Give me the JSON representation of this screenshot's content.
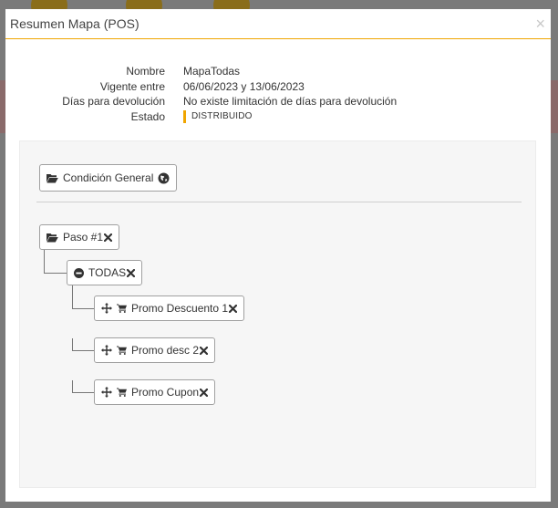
{
  "modal": {
    "title": "Resumen Mapa (POS)",
    "close": "×"
  },
  "info": {
    "rows": [
      {
        "label": "Nombre",
        "value": "MapaTodas"
      },
      {
        "label": "Vigente entre",
        "value": "06/06/2023 y 13/06/2023"
      },
      {
        "label": "Días para devolución",
        "value": "No existe limitación de días para devolución"
      }
    ],
    "status_label": "Estado",
    "status_value": "DISTRIBUIDO",
    "status_color": "#f0a500"
  },
  "tree": {
    "general": {
      "label": "Condición General",
      "icon": "folder-open-icon",
      "right_icon": "globe-icon"
    },
    "step": {
      "label": "Paso #1",
      "icon": "folder-open-icon",
      "remove": "remove-icon"
    },
    "group": {
      "label": "TODAS",
      "icon": "minus-circle-icon",
      "remove": "remove-icon"
    },
    "promos": [
      {
        "label": "Promo Descuento 1",
        "icon": "cart-icon",
        "handle": "move-icon"
      },
      {
        "label": "Promo desc 2",
        "icon": "cart-icon",
        "handle": "move-icon"
      },
      {
        "label": "Promo Cupon",
        "icon": "cart-icon",
        "handle": "move-icon"
      }
    ]
  },
  "colors": {
    "accent": "#f0a500",
    "canvas_bg": "#f6f6f6"
  }
}
